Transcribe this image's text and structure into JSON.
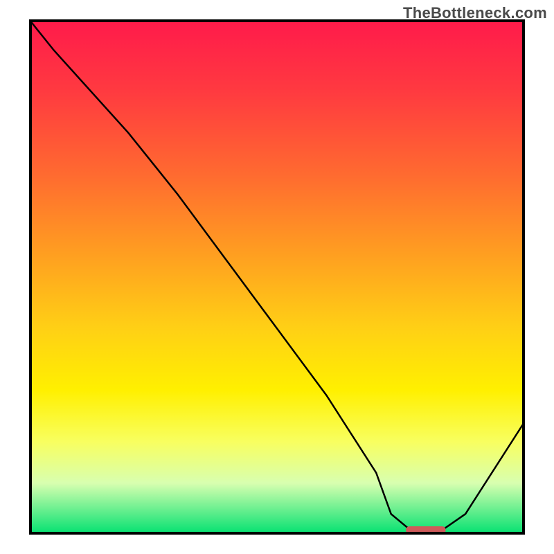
{
  "watermark": "TheBottleneck.com",
  "chart_data": {
    "type": "line",
    "title": "",
    "xlabel": "",
    "ylabel": "",
    "xlim": [
      0,
      100
    ],
    "ylim": [
      0,
      100
    ],
    "grid": false,
    "legend": false,
    "series": [
      {
        "name": "bottleneck-curve",
        "x": [
          0,
          5,
          20,
          25,
          30,
          40,
          50,
          60,
          70,
          73,
          78,
          82,
          88,
          100
        ],
        "values": [
          100,
          94,
          78,
          72,
          66,
          53,
          40,
          27,
          12,
          4,
          0,
          0,
          4,
          22
        ]
      }
    ],
    "marker": {
      "name": "optimal-range",
      "x_start": 76,
      "x_end": 84,
      "y": 0,
      "color": "#ce5a5a"
    },
    "gradient_stops": [
      {
        "pct": 0,
        "color": "#ff1a4b"
      },
      {
        "pct": 14,
        "color": "#ff3a40"
      },
      {
        "pct": 30,
        "color": "#ff6a30"
      },
      {
        "pct": 46,
        "color": "#ffa020"
      },
      {
        "pct": 60,
        "color": "#ffd015"
      },
      {
        "pct": 72,
        "color": "#fff000"
      },
      {
        "pct": 82,
        "color": "#f8ff60"
      },
      {
        "pct": 90,
        "color": "#d8ffb0"
      },
      {
        "pct": 100,
        "color": "#00e070"
      }
    ]
  }
}
